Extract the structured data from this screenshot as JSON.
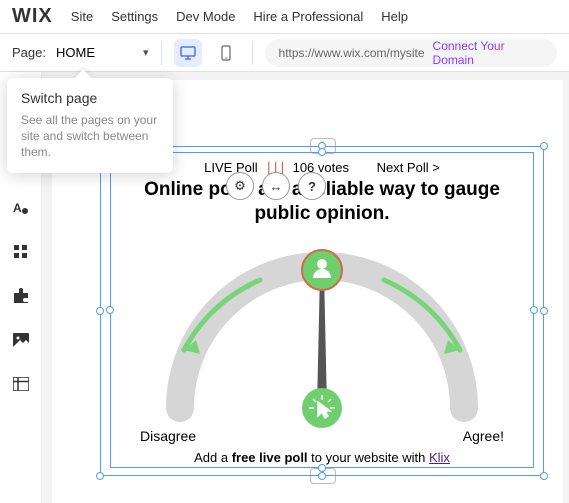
{
  "brand": "WIX",
  "menu": {
    "site": "Site",
    "settings": "Settings",
    "devmode": "Dev Mode",
    "hire": "Hire a Professional",
    "help": "Help"
  },
  "pagebar": {
    "label": "Page:",
    "current": "HOME",
    "url": "https://www.wix.com/mysite",
    "connect": "Connect Your Domain"
  },
  "tooltip": {
    "title": "Switch page",
    "body": "See all the pages on your site and switch between them."
  },
  "poll": {
    "live": "LIVE Poll",
    "votes": "106 votes",
    "next": "Next Poll >",
    "question": "Online polls are a reliable way to gauge public opinion.",
    "disagree": "Disagree",
    "agree": "Agree!",
    "cta_prefix": "Add a ",
    "cta_bold": "free live poll",
    "cta_mid": " to your website with ",
    "cta_link": "Klix"
  }
}
